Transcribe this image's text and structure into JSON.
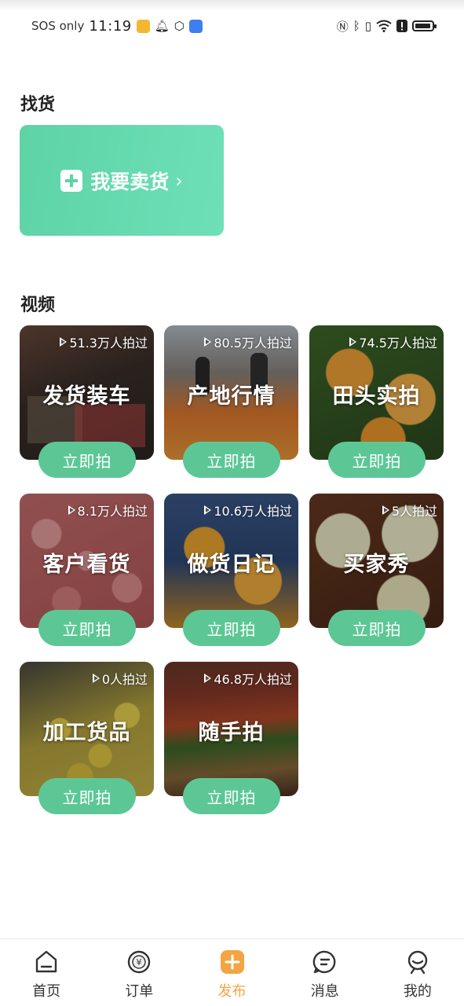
{
  "status_bar": {
    "carrier": "SOS only",
    "time": "11:19",
    "icons": [
      "app-notification-icon",
      "bell-icon",
      "box-icon",
      "app-icon",
      "nfc-icon",
      "bluetooth-icon",
      "vibrate-icon",
      "wifi-icon",
      "alert-icon",
      "battery-icon"
    ]
  },
  "find_goods": {
    "title": "找货",
    "sell_button": "我要卖货",
    "accent": "#5ed3a6"
  },
  "videos": {
    "title": "视频",
    "button_label": "立即拍",
    "button_color": "#5cc795",
    "tiles": [
      {
        "title": "发货装车",
        "count": "51.3万人拍过"
      },
      {
        "title": "产地行情",
        "count": "80.5万人拍过"
      },
      {
        "title": "田头实拍",
        "count": "74.5万人拍过"
      },
      {
        "title": "客户看货",
        "count": "8.1万人拍过"
      },
      {
        "title": "做货日记",
        "count": "10.6万人拍过"
      },
      {
        "title": "买家秀",
        "count": "5人拍过"
      },
      {
        "title": "加工货品",
        "count": "0人拍过"
      },
      {
        "title": "随手拍",
        "count": "46.8万人拍过"
      }
    ]
  },
  "bottom_nav": {
    "active_color": "#f4a443",
    "items": [
      {
        "label": "首页",
        "icon": "home-icon"
      },
      {
        "label": "订单",
        "icon": "order-icon"
      },
      {
        "label": "发布",
        "icon": "publish-icon"
      },
      {
        "label": "消息",
        "icon": "message-icon"
      },
      {
        "label": "我的",
        "icon": "profile-icon"
      }
    ]
  }
}
